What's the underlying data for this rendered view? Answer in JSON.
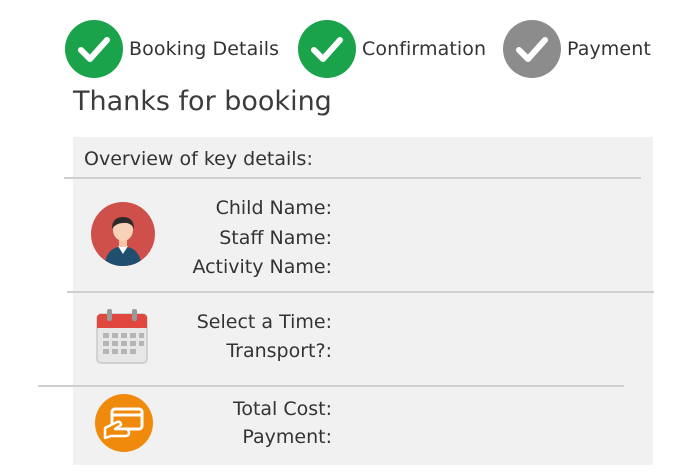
{
  "steps": [
    {
      "label": "Booking Details",
      "icon": "check-circle-icon",
      "color": "#1aa34a",
      "state": "done"
    },
    {
      "label": "Confirmation",
      "icon": "check-circle-icon",
      "color": "#1aa34a",
      "state": "done"
    },
    {
      "label": "Payment",
      "icon": "check-circle-icon",
      "color": "#8c8c8c",
      "state": "pending"
    }
  ],
  "title": "Thanks for booking",
  "overview_label": "Overview of key details:",
  "sections": [
    {
      "icon": "user-avatar-icon",
      "labels": [
        "Child Name:",
        "Staff  Name:",
        "Activity Name:"
      ]
    },
    {
      "icon": "calendar-icon",
      "labels": [
        "Select a Time:",
        "Transport?:"
      ]
    },
    {
      "icon": "credit-card-icon",
      "labels": [
        "Total Cost:",
        "Payment:"
      ]
    }
  ],
  "colors": {
    "done": "#1aa34a",
    "pending": "#8c8c8c",
    "panel_bg": "#f1f1f1",
    "avatar_bg": "#cf4f4b",
    "card_bg": "#f08a0c",
    "calendar_top": "#e0473f"
  }
}
